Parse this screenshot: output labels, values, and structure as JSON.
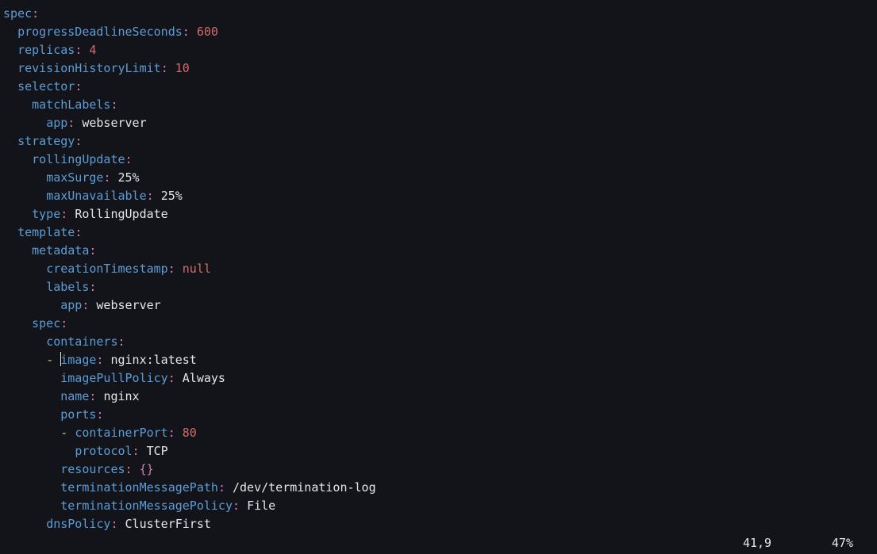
{
  "status": {
    "position": "41,9",
    "percent": "47%"
  },
  "lines": [
    [
      {
        "t": "key",
        "v": "spec"
      },
      {
        "t": "colon",
        "v": ":"
      }
    ],
    [
      {
        "t": "indent",
        "v": "  "
      },
      {
        "t": "key",
        "v": "progressDeadlineSeconds"
      },
      {
        "t": "colon",
        "v": ":"
      },
      {
        "t": "sp",
        "v": " "
      },
      {
        "t": "num",
        "v": "600"
      }
    ],
    [
      {
        "t": "indent",
        "v": "  "
      },
      {
        "t": "key",
        "v": "replicas"
      },
      {
        "t": "colon",
        "v": ":"
      },
      {
        "t": "sp",
        "v": " "
      },
      {
        "t": "num",
        "v": "4"
      }
    ],
    [
      {
        "t": "indent",
        "v": "  "
      },
      {
        "t": "key",
        "v": "revisionHistoryLimit"
      },
      {
        "t": "colon",
        "v": ":"
      },
      {
        "t": "sp",
        "v": " "
      },
      {
        "t": "num",
        "v": "10"
      }
    ],
    [
      {
        "t": "indent",
        "v": "  "
      },
      {
        "t": "key",
        "v": "selector"
      },
      {
        "t": "colon",
        "v": ":"
      }
    ],
    [
      {
        "t": "indent",
        "v": "    "
      },
      {
        "t": "key",
        "v": "matchLabels"
      },
      {
        "t": "colon",
        "v": ":"
      }
    ],
    [
      {
        "t": "indent",
        "v": "      "
      },
      {
        "t": "key",
        "v": "app"
      },
      {
        "t": "colon",
        "v": ":"
      },
      {
        "t": "sp",
        "v": " "
      },
      {
        "t": "str",
        "v": "webserver"
      }
    ],
    [
      {
        "t": "indent",
        "v": "  "
      },
      {
        "t": "key",
        "v": "strategy"
      },
      {
        "t": "colon",
        "v": ":"
      }
    ],
    [
      {
        "t": "indent",
        "v": "    "
      },
      {
        "t": "key",
        "v": "rollingUpdate"
      },
      {
        "t": "colon",
        "v": ":"
      }
    ],
    [
      {
        "t": "indent",
        "v": "      "
      },
      {
        "t": "key",
        "v": "maxSurge"
      },
      {
        "t": "colon",
        "v": ":"
      },
      {
        "t": "sp",
        "v": " "
      },
      {
        "t": "str",
        "v": "25%"
      }
    ],
    [
      {
        "t": "indent",
        "v": "      "
      },
      {
        "t": "key",
        "v": "maxUnavailable"
      },
      {
        "t": "colon",
        "v": ":"
      },
      {
        "t": "sp",
        "v": " "
      },
      {
        "t": "str",
        "v": "25%"
      }
    ],
    [
      {
        "t": "indent",
        "v": "    "
      },
      {
        "t": "key",
        "v": "type"
      },
      {
        "t": "colon",
        "v": ":"
      },
      {
        "t": "sp",
        "v": " "
      },
      {
        "t": "str",
        "v": "RollingUpdate"
      }
    ],
    [
      {
        "t": "indent",
        "v": "  "
      },
      {
        "t": "key",
        "v": "template"
      },
      {
        "t": "colon",
        "v": ":"
      }
    ],
    [
      {
        "t": "indent",
        "v": "    "
      },
      {
        "t": "key",
        "v": "metadata"
      },
      {
        "t": "colon",
        "v": ":"
      }
    ],
    [
      {
        "t": "indent",
        "v": "      "
      },
      {
        "t": "key",
        "v": "creationTimestamp"
      },
      {
        "t": "colon",
        "v": ":"
      },
      {
        "t": "sp",
        "v": " "
      },
      {
        "t": "null",
        "v": "null"
      }
    ],
    [
      {
        "t": "indent",
        "v": "      "
      },
      {
        "t": "key",
        "v": "labels"
      },
      {
        "t": "colon",
        "v": ":"
      }
    ],
    [
      {
        "t": "indent",
        "v": "        "
      },
      {
        "t": "key",
        "v": "app"
      },
      {
        "t": "colon",
        "v": ":"
      },
      {
        "t": "sp",
        "v": " "
      },
      {
        "t": "str",
        "v": "webserver"
      }
    ],
    [
      {
        "t": "indent",
        "v": "    "
      },
      {
        "t": "key",
        "v": "spec"
      },
      {
        "t": "colon",
        "v": ":"
      }
    ],
    [
      {
        "t": "indent",
        "v": "      "
      },
      {
        "t": "key",
        "v": "containers"
      },
      {
        "t": "colon",
        "v": ":"
      }
    ],
    [
      {
        "t": "indent",
        "v": "      "
      },
      {
        "t": "dash",
        "v": "- "
      },
      {
        "t": "cursor",
        "v": ""
      },
      {
        "t": "key",
        "v": "image"
      },
      {
        "t": "colon",
        "v": ":"
      },
      {
        "t": "sp",
        "v": " "
      },
      {
        "t": "str",
        "v": "nginx:latest"
      }
    ],
    [
      {
        "t": "indent",
        "v": "        "
      },
      {
        "t": "key",
        "v": "imagePullPolicy"
      },
      {
        "t": "colon",
        "v": ":"
      },
      {
        "t": "sp",
        "v": " "
      },
      {
        "t": "str",
        "v": "Always"
      }
    ],
    [
      {
        "t": "indent",
        "v": "        "
      },
      {
        "t": "key",
        "v": "name"
      },
      {
        "t": "colon",
        "v": ":"
      },
      {
        "t": "sp",
        "v": " "
      },
      {
        "t": "str",
        "v": "nginx"
      }
    ],
    [
      {
        "t": "indent",
        "v": "        "
      },
      {
        "t": "key",
        "v": "ports"
      },
      {
        "t": "colon",
        "v": ":"
      }
    ],
    [
      {
        "t": "indent",
        "v": "        "
      },
      {
        "t": "dash",
        "v": "- "
      },
      {
        "t": "key",
        "v": "containerPort"
      },
      {
        "t": "colon",
        "v": ":"
      },
      {
        "t": "sp",
        "v": " "
      },
      {
        "t": "num",
        "v": "80"
      }
    ],
    [
      {
        "t": "indent",
        "v": "          "
      },
      {
        "t": "key",
        "v": "protocol"
      },
      {
        "t": "colon",
        "v": ":"
      },
      {
        "t": "sp",
        "v": " "
      },
      {
        "t": "str",
        "v": "TCP"
      }
    ],
    [
      {
        "t": "indent",
        "v": "        "
      },
      {
        "t": "key",
        "v": "resources"
      },
      {
        "t": "colon",
        "v": ":"
      },
      {
        "t": "sp",
        "v": " "
      },
      {
        "t": "colon",
        "v": "{}"
      }
    ],
    [
      {
        "t": "indent",
        "v": "        "
      },
      {
        "t": "key",
        "v": "terminationMessagePath"
      },
      {
        "t": "colon",
        "v": ":"
      },
      {
        "t": "sp",
        "v": " "
      },
      {
        "t": "str",
        "v": "/dev/termination-log"
      }
    ],
    [
      {
        "t": "indent",
        "v": "        "
      },
      {
        "t": "key",
        "v": "terminationMessagePolicy"
      },
      {
        "t": "colon",
        "v": ":"
      },
      {
        "t": "sp",
        "v": " "
      },
      {
        "t": "str",
        "v": "File"
      }
    ],
    [
      {
        "t": "indent",
        "v": "      "
      },
      {
        "t": "key",
        "v": "dnsPolicy"
      },
      {
        "t": "colon",
        "v": ":"
      },
      {
        "t": "sp",
        "v": " "
      },
      {
        "t": "str",
        "v": "ClusterFirst"
      }
    ]
  ]
}
